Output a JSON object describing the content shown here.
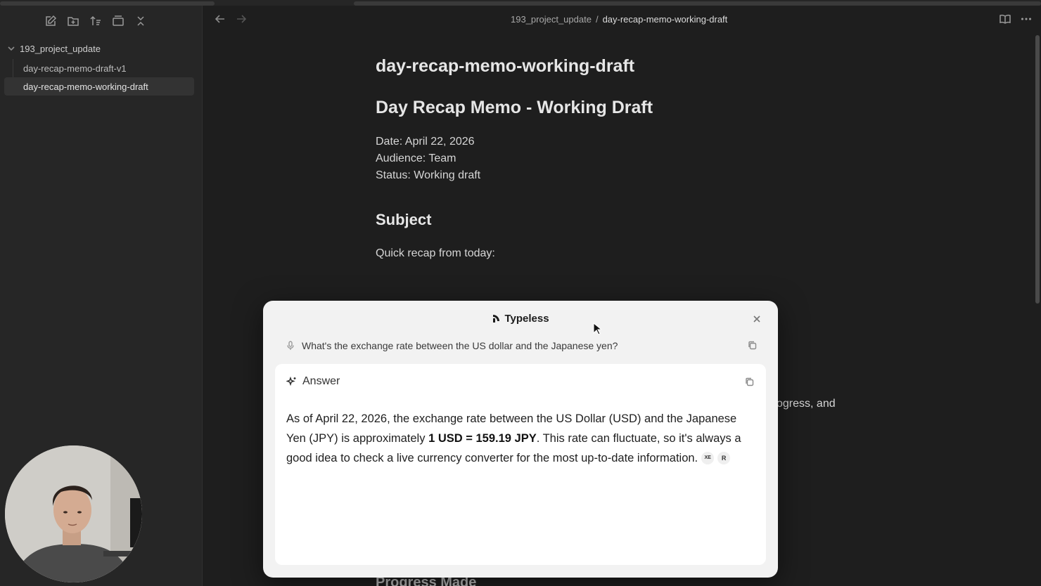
{
  "sidebar": {
    "toolbar_icons": [
      "new-note-icon",
      "new-folder-icon",
      "sort-icon",
      "collapse-icon",
      "close-all-icon"
    ],
    "folder": "193_project_update",
    "files": [
      {
        "label": "day-recap-memo-draft-v1",
        "active": false
      },
      {
        "label": "day-recap-memo-working-draft",
        "active": true
      }
    ]
  },
  "header": {
    "breadcrumb_parent": "193_project_update",
    "breadcrumb_sep": "/",
    "breadcrumb_current": "day-recap-memo-working-draft"
  },
  "doc": {
    "inline_title": "day-recap-memo-working-draft",
    "h1": "Day Recap Memo - Working Draft",
    "meta": [
      "Date: April 22, 2026",
      "Audience: Team",
      "Status: Working draft"
    ],
    "subject_heading": "Subject",
    "intro": "Quick recap from today:",
    "peek_text": "ogress, and",
    "peek_heading": "Progress Made"
  },
  "modal": {
    "title": "Typeless",
    "query": "What's the exchange rate between the US dollar and the Japanese yen?",
    "answer_label": "Answer",
    "answer_pre": "As of April 22, 2026, the exchange rate between the US Dollar (USD) and the Japanese Yen (JPY) is approximately ",
    "answer_bold": "1 USD = 159.19 JPY",
    "answer_post": ". This rate can fluctuate, so it's always a good idea to check a live currency converter for the most up-to-date information.",
    "source_badges": [
      "XE",
      "R"
    ]
  },
  "colors": {
    "app_bg": "#1e1e1e",
    "sidebar_bg": "#262626",
    "modal_bg": "#f2f2f2",
    "answer_bg": "#ffffff"
  }
}
